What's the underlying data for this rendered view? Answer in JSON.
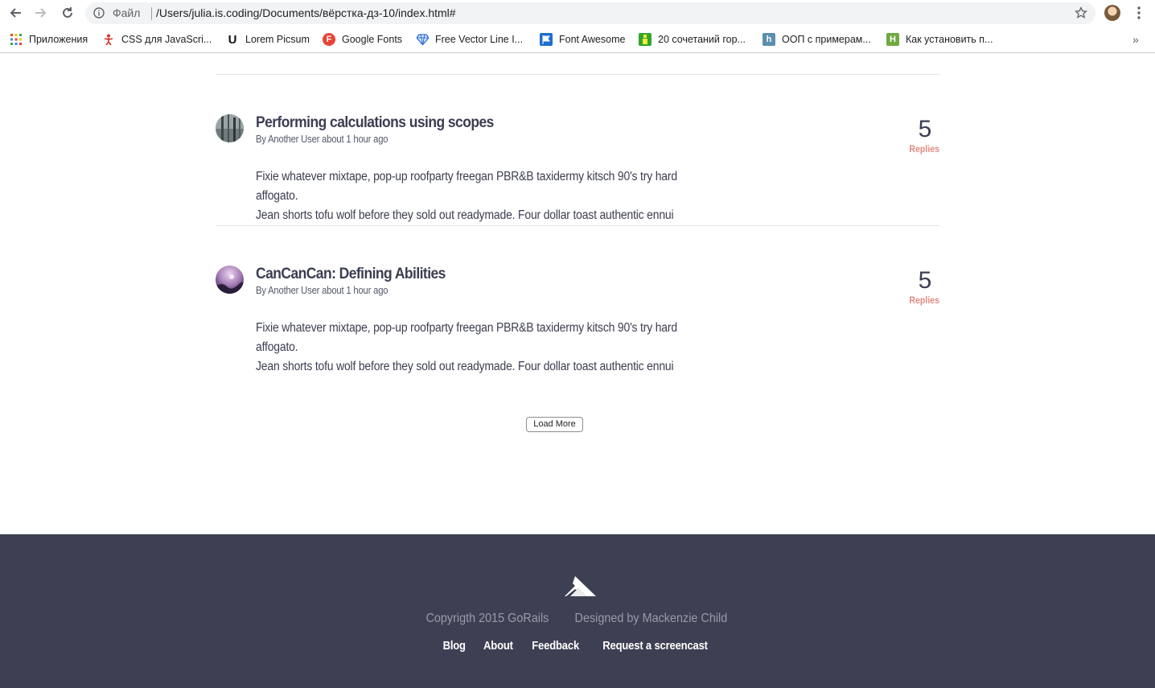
{
  "browser": {
    "file_label": "Файл",
    "url": "/Users/julia.is.coding/Documents/вёрстка-дз-10/index.html#"
  },
  "bookmarks": [
    {
      "label": "Приложения",
      "icon": "apps-grid-icon",
      "color": "#4285f4"
    },
    {
      "label": "CSS для JavaScri...",
      "icon": "css-person-icon",
      "color": "#d93025"
    },
    {
      "label": "Lorem Picsum",
      "icon": "u-letter-icon",
      "color": "#111111"
    },
    {
      "label": "Google Fonts",
      "icon": "google-fonts-icon",
      "color": "#ea4335"
    },
    {
      "label": "Free Vector Line I...",
      "icon": "diamond-icon",
      "color": "#2b6cd6"
    },
    {
      "label": "Font Awesome",
      "icon": "flag-icon",
      "color": "#1c6fd1"
    },
    {
      "label": "20 сочетаний гор...",
      "icon": "green-figure-icon",
      "color": "#2fa52a"
    },
    {
      "label": "ООП с примерам...",
      "icon": "h-letter-icon",
      "color": "#5b8fb0"
    },
    {
      "label": "Как установить п...",
      "icon": "green-square-icon",
      "color": "#6fa83f"
    }
  ],
  "posts": [
    {
      "title": "Performing calculations using scopes",
      "meta": "By Another User about 1 hour ago",
      "body_line1": "Fixie whatever mixtape, pop-up roofparty freegan PBR&B taxidermy kitsch 90's try hard affogato.",
      "body_line2": "Jean shorts tofu wolf before they sold out readymade. Four dollar toast authentic ennui",
      "count": "5",
      "count_label": "Replies"
    },
    {
      "title": "CanCanCan: Defining Abilities",
      "meta": "By Another User about 1 hour ago",
      "body_line1": "Fixie whatever mixtape, pop-up roofparty freegan PBR&B taxidermy kitsch 90's try hard affogato.",
      "body_line2": "Jean shorts tofu wolf before they sold out readymade. Four dollar toast authentic ennui",
      "count": "5",
      "count_label": "Replies"
    }
  ],
  "load_more": "Load More",
  "footer": {
    "copyright": "Copyrigth 2015 GoRails",
    "designed": "Designed by Mackenzie Child",
    "links": [
      "Blog",
      "About",
      "Feedback",
      "Request a screencast"
    ]
  },
  "colors": {
    "footer_bg": "#3d3f52",
    "accent": "#e28a80",
    "text": "#3b3e52"
  }
}
